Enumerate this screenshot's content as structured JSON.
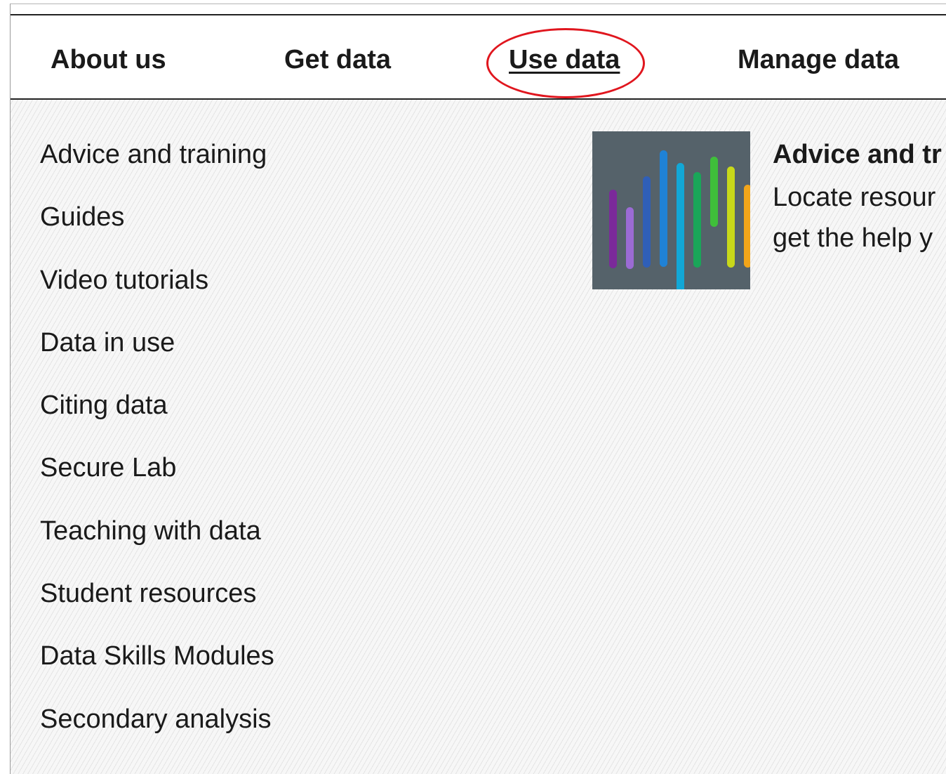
{
  "nav": {
    "items": [
      {
        "label": "About us"
      },
      {
        "label": "Get data"
      },
      {
        "label": "Use data",
        "active": true
      },
      {
        "label": "Manage data"
      }
    ],
    "highlight_color": "#e0161e"
  },
  "menu": {
    "links": [
      "Advice and training",
      "Guides",
      "Video tutorials",
      "Data in use",
      "Citing data",
      "Secure Lab",
      "Teaching with data",
      "Student resources",
      "Data Skills Modules",
      "Secondary analysis"
    ]
  },
  "feature": {
    "title": "Advice and tr",
    "desc_line1": "Locate resour",
    "desc_line2": "get the help y",
    "image_icon": "colored-bars-thumbnail",
    "bar_colors": [
      "#7b2a9a",
      "#9b6bd4",
      "#2f5fb8",
      "#1f82d6",
      "#12a7d6",
      "#1aa659",
      "#3fbf3a",
      "#c8d81a",
      "#f2a51a"
    ]
  }
}
